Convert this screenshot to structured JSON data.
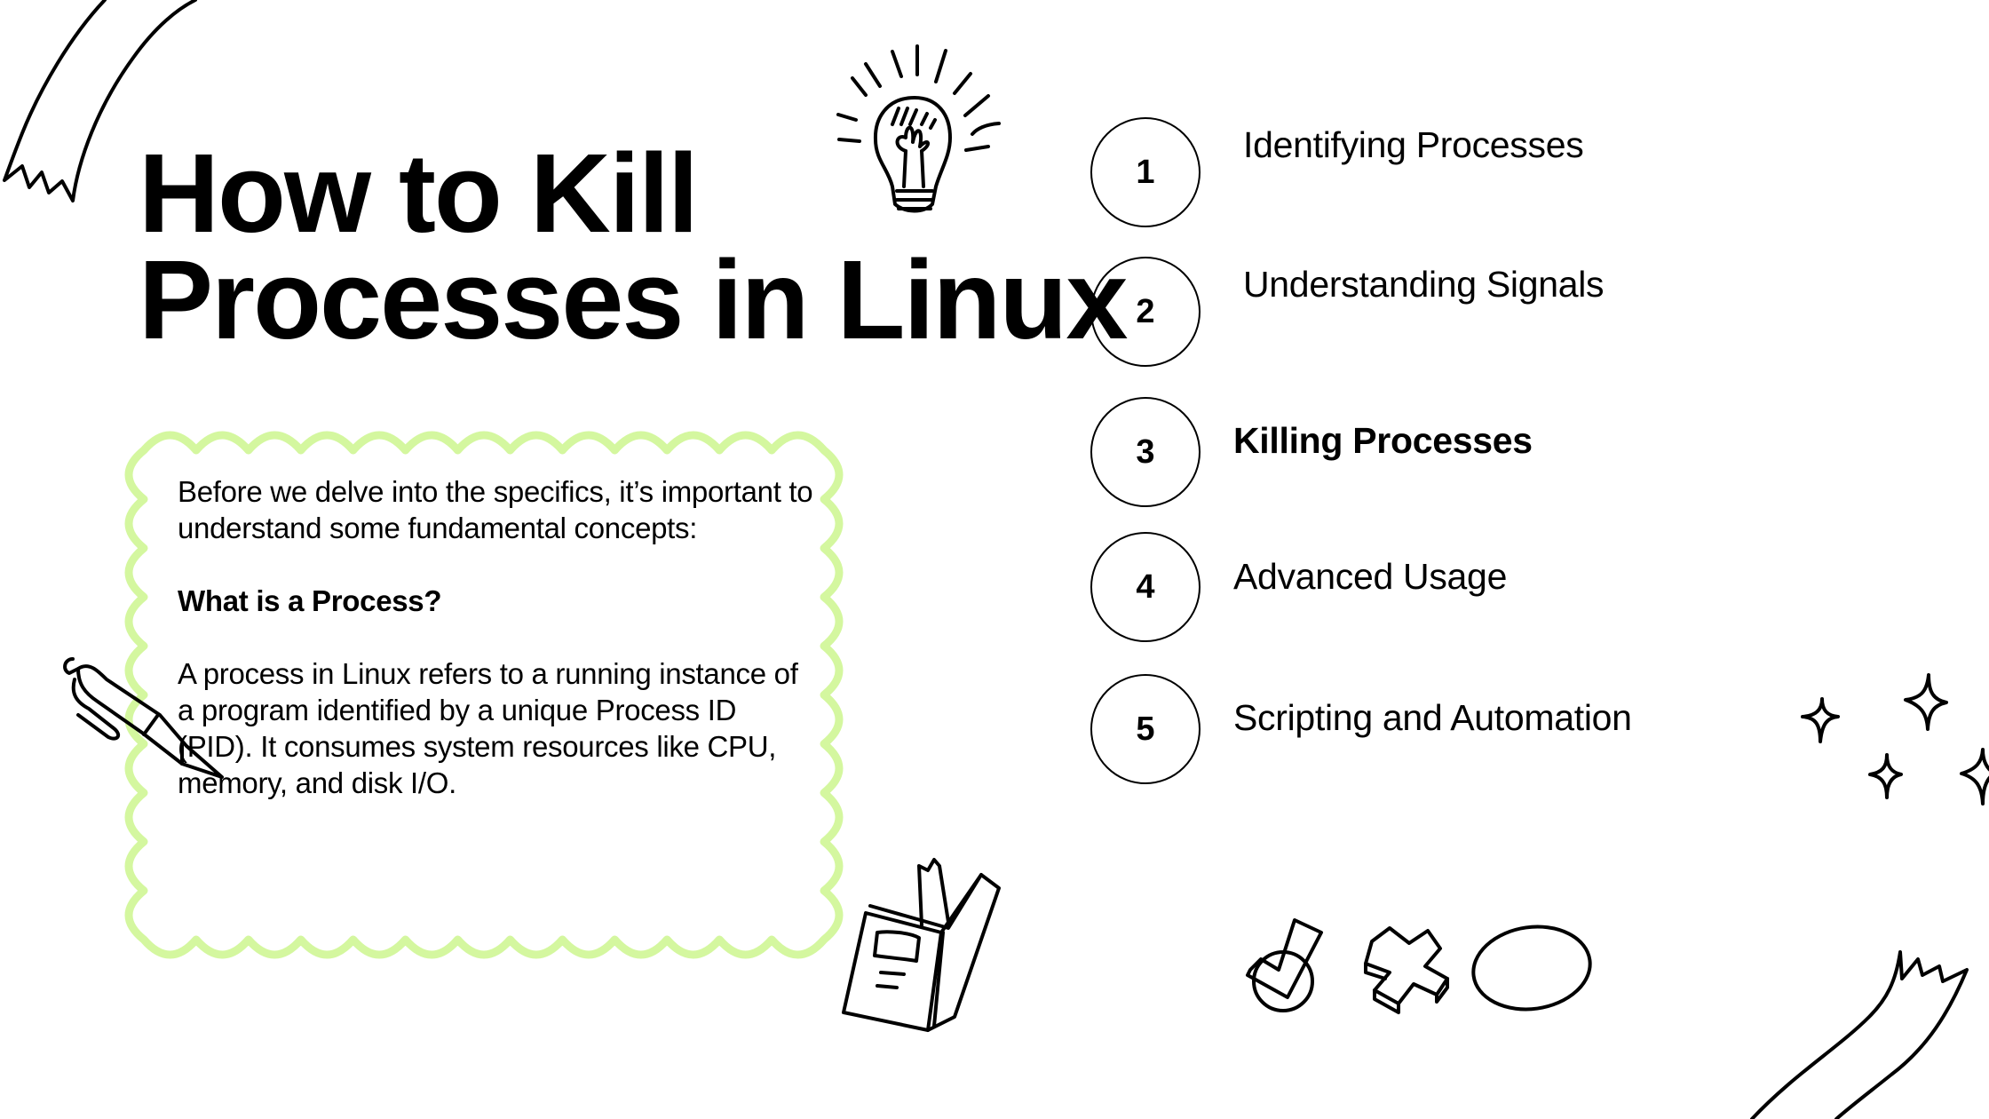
{
  "slide": {
    "title_lines": [
      "How to Kill",
      "Processes in Linux"
    ],
    "accent_color": "#d4f79f",
    "intro_box": {
      "paragraph_1": "Before we delve into the specifics, it’s important to understand some fundamental concepts:",
      "heading": "What is a Process?",
      "paragraph_2": "A process in Linux refers to a running instance of a program identified by a unique Process ID (PID). It consumes system resources like CPU, memory, and disk I/O."
    },
    "agenda": [
      {
        "number": "1",
        "label": "Identifying Processes",
        "active": false
      },
      {
        "number": "2",
        "label": "Understanding Signals",
        "active": false
      },
      {
        "number": "3",
        "label": "Killing Processes",
        "active": true
      },
      {
        "number": "4",
        "label": "Advanced Usage",
        "active": false
      },
      {
        "number": "5",
        "label": "Scripting and Automation",
        "active": false
      }
    ],
    "decorations": [
      "ribbon-top-left",
      "lightbulb",
      "pen",
      "book",
      "sparkles",
      "checkmark",
      "cross",
      "circle",
      "ribbon-bottom-right"
    ]
  }
}
